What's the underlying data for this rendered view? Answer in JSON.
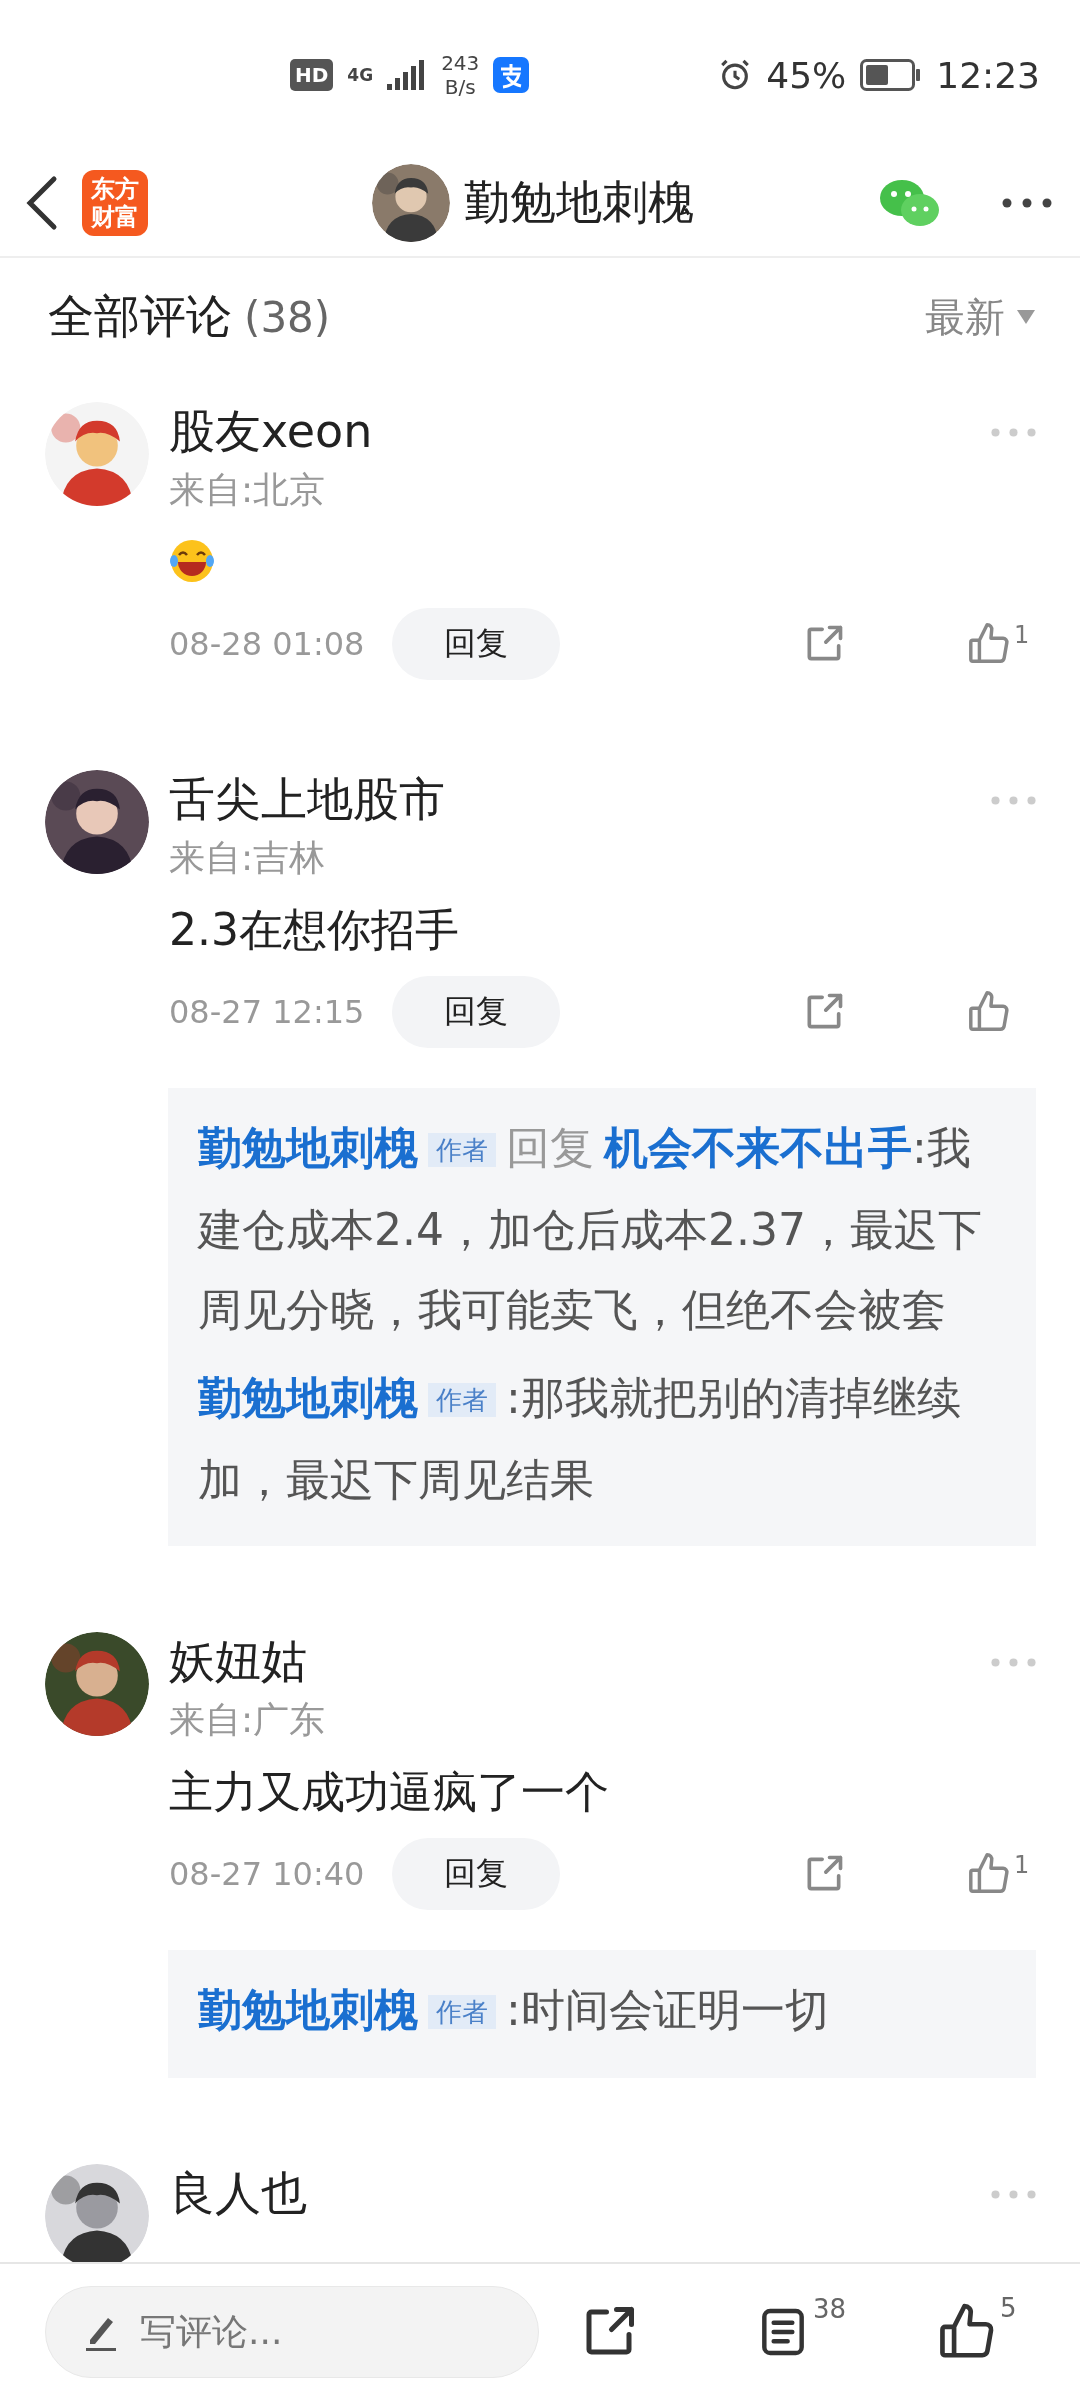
{
  "status_bar": {
    "hd": "HD",
    "network": "4G",
    "speed_value": "243",
    "speed_unit": "B/s",
    "battery": "45%",
    "time": "12:23"
  },
  "header": {
    "logo_lines": [
      "东方",
      "财富"
    ],
    "title": "勤勉地刺槐"
  },
  "comments_header": {
    "title": "全部评论",
    "count": "(38)",
    "sort": "最新"
  },
  "comments": [
    {
      "name": "股友xeon",
      "location": "来自:北京",
      "kind": "emoji",
      "time": "08-28 01:08",
      "reply_button": "回复",
      "likes": "1"
    },
    {
      "name": "舌尖上地股市",
      "location": "来自:吉林",
      "kind": "text",
      "content": "2.3在想你招手",
      "time": "08-27 12:15",
      "reply_button": "回复",
      "replies": [
        {
          "author": "勤勉地刺槐",
          "badge": "作者",
          "reply_word": "回复",
          "reply_to": "机会不来不出手",
          "text": ":我建仓成本2.4，加仓后成本2.37，最迟下周见分晓，我可能卖飞，但绝不会被套"
        },
        {
          "author": "勤勉地刺槐",
          "badge": "作者",
          "text": ":那我就把别的清掉继续加，最迟下周见结果"
        }
      ]
    },
    {
      "name": "妖妞姑",
      "location": "来自:广东",
      "kind": "text",
      "content": "主力又成功逼疯了一个",
      "time": "08-27 10:40",
      "reply_button": "回复",
      "likes": "1",
      "replies": [
        {
          "author": "勤勉地刺槐",
          "badge": "作者",
          "text": ":时间会证明一切"
        }
      ]
    },
    {
      "name": "良人也",
      "kind": "text"
    }
  ],
  "bottom_bar": {
    "placeholder": "写评论...",
    "comment_count": "38",
    "like_count": "5"
  }
}
